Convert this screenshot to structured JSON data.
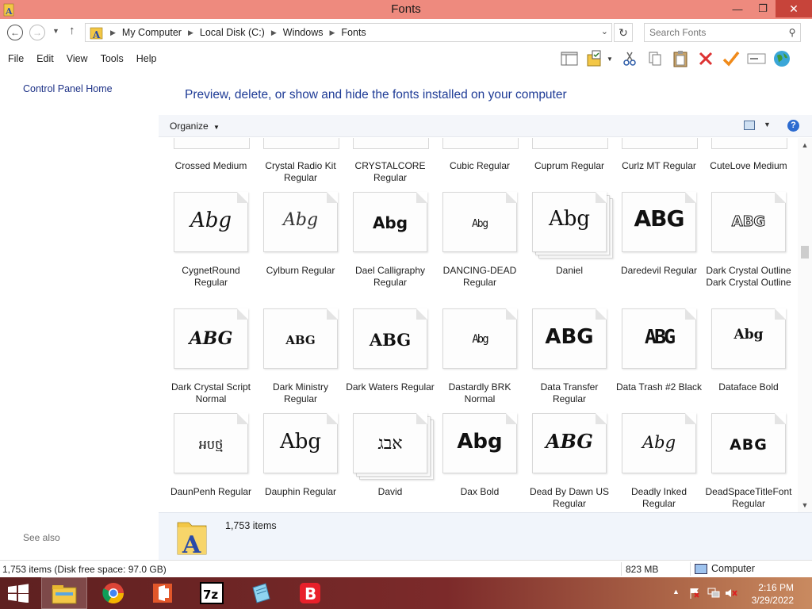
{
  "window": {
    "title": "Fonts",
    "controls": {
      "minimize": "—",
      "maximize": "❐",
      "close": "✕"
    }
  },
  "address": {
    "crumbs": [
      "My Computer",
      "Local Disk (C:)",
      "Windows",
      "Fonts"
    ],
    "search_placeholder": "Search Fonts"
  },
  "menu": [
    "File",
    "Edit",
    "View",
    "Tools",
    "Help"
  ],
  "toolbar": {
    "icons": [
      "layout-pane-icon",
      "properties-icon",
      "cut-icon",
      "copy-icon",
      "paste-icon",
      "delete-icon",
      "checkmark-icon",
      "rename-icon",
      "globe-icon"
    ]
  },
  "nav": {
    "control_panel_home": "Control Panel Home",
    "see_also": "See also"
  },
  "content": {
    "heading": "Preview, delete, or show and hide the fonts installed on your computer",
    "organize": "Organize"
  },
  "fonts": {
    "row0": [
      "Crossed Medium",
      "Crystal Radio Kit Regular",
      "CRYSTALCORE Regular",
      "Cubic Regular",
      "Cuprum Regular",
      "Curlz MT Regular",
      "CuteLove Medium"
    ],
    "row1": [
      {
        "name": "CygnetRound Regular",
        "sample": "Abg",
        "stacked": false
      },
      {
        "name": "Cylburn Regular",
        "sample": "Abg",
        "stacked": false
      },
      {
        "name": "Dael Calligraphy Regular",
        "sample": "Abg",
        "stacked": false
      },
      {
        "name": "DANCING-DEAD Regular",
        "sample": "Abg",
        "stacked": false
      },
      {
        "name": "Daniel",
        "sample": "Abg",
        "stacked": true
      },
      {
        "name": "Daredevil Regular",
        "sample": "ABG",
        "stacked": false
      },
      {
        "name": "Dark Crystal Outline Dark Crystal Outline",
        "sample": "ABG",
        "stacked": false
      }
    ],
    "row2": [
      {
        "name": "Dark Crystal Script Normal",
        "sample": "ABG",
        "stacked": false
      },
      {
        "name": "Dark Ministry Regular",
        "sample": "ABG",
        "stacked": false
      },
      {
        "name": "Dark Waters Regular",
        "sample": "ABG",
        "stacked": false
      },
      {
        "name": "Dastardly BRK Normal",
        "sample": "Abg",
        "stacked": false
      },
      {
        "name": "Data Transfer Regular",
        "sample": "ABG",
        "stacked": false
      },
      {
        "name": "Data Trash #2 Black",
        "sample": "ABG",
        "stacked": false
      },
      {
        "name": "Dataface Bold",
        "sample": "Abg",
        "stacked": false
      }
    ],
    "row3": [
      {
        "name": "DaunPenh Regular",
        "sample": "ឣបថ្ម",
        "stacked": false
      },
      {
        "name": "Dauphin Regular",
        "sample": "Abg",
        "stacked": false
      },
      {
        "name": "David",
        "sample": "אבג",
        "stacked": true
      },
      {
        "name": "Dax Bold",
        "sample": "Abg",
        "stacked": false
      },
      {
        "name": "Dead By Dawn US Regular",
        "sample": "ABG",
        "stacked": false
      },
      {
        "name": "Deadly Inked Regular",
        "sample": "Abg",
        "stacked": false
      },
      {
        "name": "DeadSpaceTitleFont Regular",
        "sample": "ABG",
        "stacked": false
      }
    ]
  },
  "details": {
    "count": "1,753 items"
  },
  "status": {
    "items_free": "1,753 items (Disk free space: 97.0 GB)",
    "size": "823 MB",
    "location": "Computer"
  },
  "taskbar": {
    "apps": [
      "file-explorer-icon",
      "chrome-icon",
      "office-icon",
      "7zip-icon",
      "notepad-icon",
      "bitdefender-icon"
    ],
    "time": "2:16 PM",
    "date": "3/29/2022"
  },
  "colors": {
    "titlebar": "#ee8a7e",
    "close": "#c7443a",
    "heading": "#1e3b96",
    "link": "#1e3287"
  }
}
